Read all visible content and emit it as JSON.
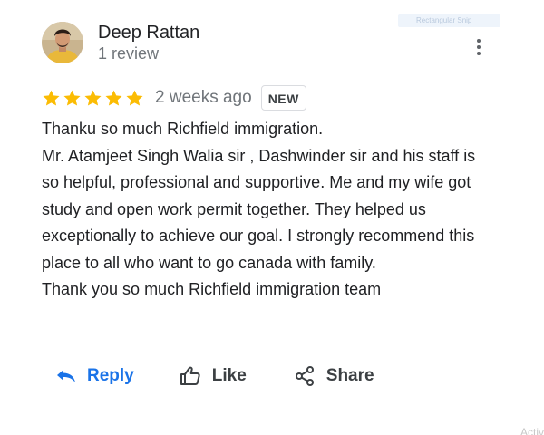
{
  "overlay": {
    "label": "Rectangular Snip"
  },
  "review": {
    "author_name": "Deep Rattan",
    "author_meta": "1 review",
    "rating": 5,
    "rating_max": 5,
    "date": "2 weeks ago",
    "badge": "NEW",
    "lines": [
      "Thanku so much Richfield immigration.",
      "Mr. Atamjeet Singh Walia sir , Dashwinder sir and his staff is so helpful, professional and supportive. Me and my wife got study and open work permit together. They helped us exceptionally to achieve our goal. I strongly recommend this place to all who want to go canada with family.",
      "Thank you so much Richfield immigration team"
    ]
  },
  "actions": {
    "reply_label": "Reply",
    "like_label": "Like",
    "share_label": "Share"
  },
  "watermark": {
    "text": "Activ"
  },
  "colors": {
    "star": "#fbbc04",
    "link_blue": "#1a73e8",
    "secondary_text": "#70757a"
  },
  "icons": {
    "reply": "reply-arrow-icon",
    "like": "thumb-up-icon",
    "share": "share-icon",
    "more": "more-vertical-icon"
  }
}
